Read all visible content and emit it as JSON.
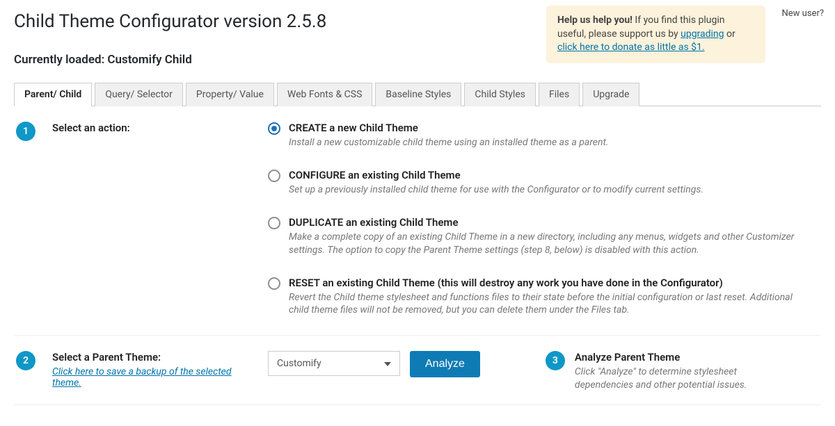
{
  "page_title": "Child Theme Configurator version 2.5.8",
  "new_user_label": "New user?",
  "notice": {
    "lead": "Help us help you!",
    "rest": " If you find this plugin useful, please support us by ",
    "upgrade_link": "upgrading",
    "or_text": " or ",
    "donate_link": "click here to donate as little as $1."
  },
  "loaded": "Currently loaded: Customify Child",
  "tabs": [
    "Parent/ Child",
    "Query/ Selector",
    "Property/ Value",
    "Web Fonts & CSS",
    "Baseline Styles",
    "Child Styles",
    "Files",
    "Upgrade"
  ],
  "step1": {
    "num": "1",
    "label": "Select an action:",
    "options": [
      {
        "title": "CREATE a new Child Theme",
        "desc": "Install a new customizable child theme using an installed theme as a parent.",
        "checked": true
      },
      {
        "title": "CONFIGURE an existing Child Theme",
        "desc": "Set up a previously installed child theme for use with the Configurator or to modify current settings.",
        "checked": false
      },
      {
        "title": "DUPLICATE an existing Child Theme",
        "desc": "Make a complete copy of an existing Child Theme in a new directory, including any menus, widgets and other Customizer settings. The option to copy the Parent Theme settings (step 8, below) is disabled with this action.",
        "checked": false
      },
      {
        "title": "RESET an existing Child Theme (this will destroy any work you have done in the Configurator)",
        "desc": "Revert the Child theme stylesheet and functions files to their state before the initial configuration or last reset. Additional child theme files will not be removed, but you can delete them under the Files tab.",
        "checked": false
      }
    ]
  },
  "step2": {
    "num": "2",
    "label": "Select a Parent Theme:",
    "sublink": "Click here to save a backup of the selected theme.",
    "select_value": "Customify",
    "button": "Analyze"
  },
  "step3": {
    "num": "3",
    "title": "Analyze Parent Theme",
    "desc": "Click \"Analyze\" to determine stylesheet dependencies and other potential issues."
  }
}
